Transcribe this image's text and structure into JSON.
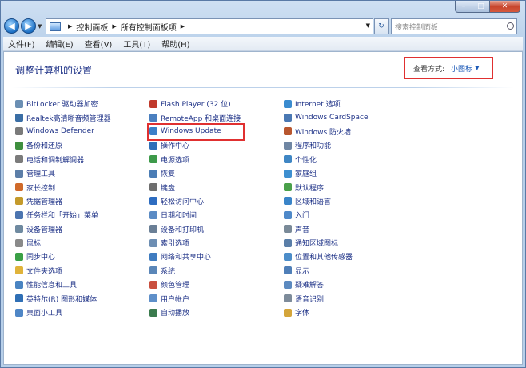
{
  "window": {
    "caption": {
      "minimize": "–",
      "maximize": "□",
      "close": "✕"
    }
  },
  "address_bar": {
    "crumbs": [
      "控制面板",
      "所有控制面板项"
    ],
    "search_placeholder": "搜索控制面板"
  },
  "menu": [
    "文件(F)",
    "编辑(E)",
    "查看(V)",
    "工具(T)",
    "帮助(H)"
  ],
  "page": {
    "title": "调整计算机的设置",
    "view_by_label": "查看方式:",
    "view_by_value": "小图标"
  },
  "columns": [
    [
      {
        "label": "BitLocker 驱动器加密",
        "color": "#6b8fb3"
      },
      {
        "label": "Realtek高清晰音频管理器",
        "color": "#3a6ea5"
      },
      {
        "label": "Windows Defender",
        "color": "#7a7a7a"
      },
      {
        "label": "备份和还原",
        "color": "#3e8f3e"
      },
      {
        "label": "电话和调制解调器",
        "color": "#7b7b7b"
      },
      {
        "label": "管理工具",
        "color": "#5c7ea8"
      },
      {
        "label": "家长控制",
        "color": "#d06a2a"
      },
      {
        "label": "凭据管理器",
        "color": "#c49a2b"
      },
      {
        "label": "任务栏和「开始」菜单",
        "color": "#4c75b0"
      },
      {
        "label": "设备管理器",
        "color": "#6f8aa0"
      },
      {
        "label": "鼠标",
        "color": "#8a8a8a"
      },
      {
        "label": "同步中心",
        "color": "#3aa046"
      },
      {
        "label": "文件夹选项",
        "color": "#e0b33a"
      },
      {
        "label": "性能信息和工具",
        "color": "#4a84c2"
      },
      {
        "label": "英特尔(R) 图形和媒体",
        "color": "#2f6fb5"
      },
      {
        "label": "桌面小工具",
        "color": "#4f86c6"
      }
    ],
    [
      {
        "label": "Flash Player (32 位)",
        "color": "#c0392b"
      },
      {
        "label": "RemoteApp 和桌面连接",
        "color": "#4a7fbf"
      },
      {
        "label": "Windows Update",
        "color": "#3a7fc9"
      },
      {
        "label": "操作中心",
        "color": "#2e6fb8"
      },
      {
        "label": "电源选项",
        "color": "#3d9a4a"
      },
      {
        "label": "恢复",
        "color": "#4b7db5"
      },
      {
        "label": "键盘",
        "color": "#6e6e6e"
      },
      {
        "label": "轻松访问中心",
        "color": "#2d6cc0"
      },
      {
        "label": "日期和时间",
        "color": "#5b8bc4"
      },
      {
        "label": "设备和打印机",
        "color": "#6a7f96"
      },
      {
        "label": "索引选项",
        "color": "#6d8eb3"
      },
      {
        "label": "网络和共享中心",
        "color": "#3f7cc0"
      },
      {
        "label": "系统",
        "color": "#5a86b8"
      },
      {
        "label": "颜色管理",
        "color": "#c94f3f"
      },
      {
        "label": "用户帐户",
        "color": "#5e8fc9"
      },
      {
        "label": "自动播放",
        "color": "#3b7b4e"
      }
    ],
    [
      {
        "label": "Internet 选项",
        "color": "#3a8bcf"
      },
      {
        "label": "Windows CardSpace",
        "color": "#4a78b3"
      },
      {
        "label": "Windows 防火墙",
        "color": "#b8562e"
      },
      {
        "label": "程序和功能",
        "color": "#6f86a3"
      },
      {
        "label": "个性化",
        "color": "#3f86c4"
      },
      {
        "label": "家庭组",
        "color": "#3d8fd0"
      },
      {
        "label": "默认程序",
        "color": "#4aa04a"
      },
      {
        "label": "区域和语言",
        "color": "#3a84c8"
      },
      {
        "label": "入门",
        "color": "#4f89c9"
      },
      {
        "label": "声音",
        "color": "#7a8a98"
      },
      {
        "label": "通知区域图标",
        "color": "#5a7ea8"
      },
      {
        "label": "位置和其他传感器",
        "color": "#4c8dc9"
      },
      {
        "label": "显示",
        "color": "#4f7fb8"
      },
      {
        "label": "疑难解答",
        "color": "#5c8ac0"
      },
      {
        "label": "语音识别",
        "color": "#7d8b9a"
      },
      {
        "label": "字体",
        "color": "#d4a53a"
      }
    ]
  ]
}
